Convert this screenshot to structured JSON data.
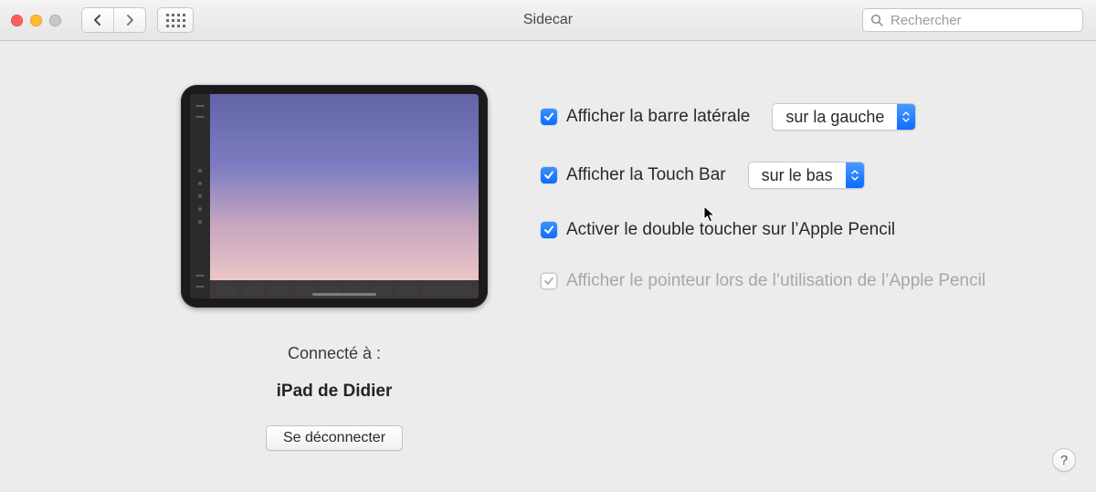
{
  "window": {
    "title": "Sidecar",
    "search_placeholder": "Rechercher"
  },
  "device": {
    "connected_label": "Connecté à :",
    "name": "iPad de Didier",
    "disconnect_label": "Se déconnecter"
  },
  "options": {
    "show_sidebar": {
      "label": "Afficher la barre latérale",
      "checked": true,
      "select_value": "sur la gauche"
    },
    "show_touchbar": {
      "label": "Afficher la Touch Bar",
      "checked": true,
      "select_value": "sur le bas"
    },
    "double_tap_pencil": {
      "label": "Activer le double toucher sur l’Apple Pencil",
      "checked": true
    },
    "show_pointer_pencil": {
      "label": "Afficher le pointeur lors de l’utilisation de l’Apple Pencil",
      "checked": true,
      "disabled": true
    }
  },
  "help_label": "?"
}
